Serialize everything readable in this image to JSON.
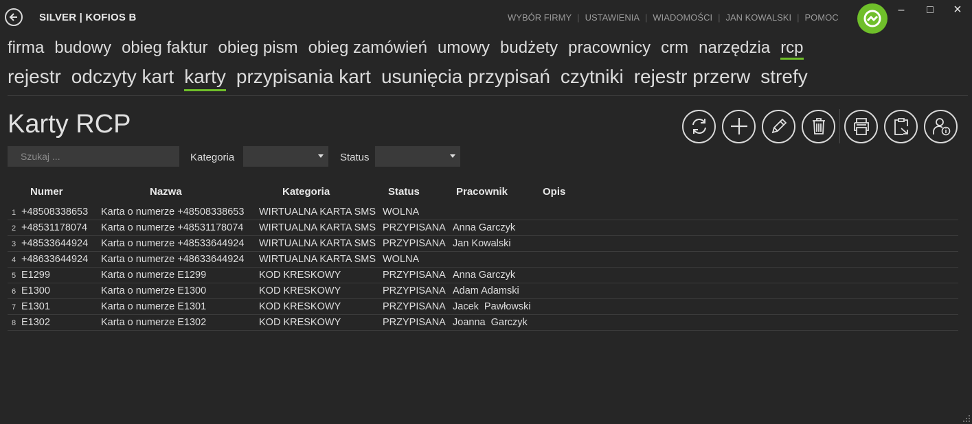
{
  "app": {
    "title": "SILVER | KOFIOS B"
  },
  "top_menu": [
    "WYBÓR FIRMY",
    "USTAWIENIA",
    "WIADOMOŚCI",
    "JAN KOWALSKI",
    "POMOC"
  ],
  "window_controls": {
    "minimize": "–",
    "maximize": "□",
    "close": "×"
  },
  "nav_main": [
    {
      "label": "firma"
    },
    {
      "label": "budowy"
    },
    {
      "label": "obieg faktur"
    },
    {
      "label": "obieg pism"
    },
    {
      "label": "obieg zamówień"
    },
    {
      "label": "umowy"
    },
    {
      "label": "budżety"
    },
    {
      "label": "pracownicy"
    },
    {
      "label": "crm"
    },
    {
      "label": "narzędzia"
    },
    {
      "label": "rcp"
    }
  ],
  "nav_sub": [
    {
      "label": "rejestr"
    },
    {
      "label": "odczyty kart"
    },
    {
      "label": "karty"
    },
    {
      "label": "przypisania kart"
    },
    {
      "label": "usunięcia przypisań"
    },
    {
      "label": "czytniki"
    },
    {
      "label": "rejestr przerw"
    },
    {
      "label": "strefy"
    }
  ],
  "page": {
    "title": "Karty RCP"
  },
  "toolbar_icons": [
    "refresh-icon",
    "add-icon",
    "edit-icon",
    "delete-icon",
    "print-icon",
    "clipboard-export-icon",
    "user-info-icon"
  ],
  "filters": {
    "search_placeholder": "Szukaj ...",
    "search_value": "",
    "category_label": "Kategoria",
    "category_value": "",
    "status_label": "Status",
    "status_value": ""
  },
  "table": {
    "columns": [
      "Numer",
      "Nazwa",
      "Kategoria",
      "Status",
      "Pracownik",
      "Opis"
    ],
    "rows": [
      {
        "idx": "1",
        "numer": "+48508338653",
        "nazwa": "Karta o numerze +48508338653",
        "kategoria": "WIRTUALNA KARTA SMS",
        "status": "WOLNA",
        "pracownik": "",
        "opis": ""
      },
      {
        "idx": "2",
        "numer": "+48531178074",
        "nazwa": "Karta o numerze +48531178074",
        "kategoria": "WIRTUALNA KARTA SMS",
        "status": "PRZYPISANA",
        "pracownik": "Anna Garczyk",
        "opis": ""
      },
      {
        "idx": "3",
        "numer": "+48533644924",
        "nazwa": "Karta o numerze +48533644924",
        "kategoria": "WIRTUALNA KARTA SMS",
        "status": "PRZYPISANA",
        "pracownik": "Jan Kowalski",
        "opis": ""
      },
      {
        "idx": "4",
        "numer": "+48633644924",
        "nazwa": "Karta o numerze +48633644924",
        "kategoria": "WIRTUALNA KARTA SMS",
        "status": "WOLNA",
        "pracownik": "",
        "opis": ""
      },
      {
        "idx": "5",
        "numer": "E1299",
        "nazwa": "Karta o numerze E1299",
        "kategoria": "KOD KRESKOWY",
        "status": "PRZYPISANA",
        "pracownik": "Anna Garczyk",
        "opis": ""
      },
      {
        "idx": "6",
        "numer": "E1300",
        "nazwa": "Karta o numerze E1300",
        "kategoria": "KOD KRESKOWY",
        "status": "PRZYPISANA",
        "pracownik": "Adam Adamski",
        "opis": ""
      },
      {
        "idx": "7",
        "numer": "E1301",
        "nazwa": "Karta o numerze E1301",
        "kategoria": "KOD KRESKOWY",
        "status": "PRZYPISANA",
        "pracownik": "Jacek  Pawłowski",
        "opis": ""
      },
      {
        "idx": "8",
        "numer": "E1302",
        "nazwa": "Karta o numerze E1302",
        "kategoria": "KOD KRESKOWY",
        "status": "PRZYPISANA",
        "pracownik": "Joanna  Garczyk",
        "opis": ""
      }
    ]
  },
  "colors": {
    "background": "#262626",
    "accent": "#6fbf2a",
    "input_bg": "#3a3a3a"
  }
}
